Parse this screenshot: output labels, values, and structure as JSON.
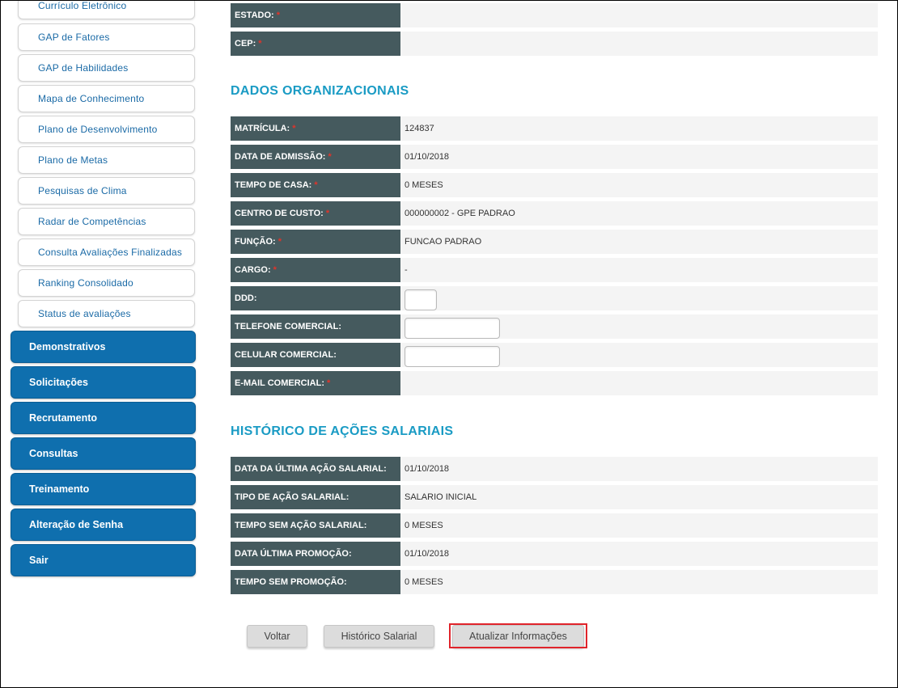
{
  "sidebar": {
    "subitems": [
      "Currículo Eletrônico",
      "GAP de Fatores",
      "GAP de Habilidades",
      "Mapa de Conhecimento",
      "Plano de Desenvolvimento",
      "Plano de Metas",
      "Pesquisas de Clima",
      "Radar de Competências",
      "Consulta Avaliações Finalizadas",
      "Ranking Consolidado",
      "Status de avaliações"
    ],
    "main_items": [
      "Demonstrativos",
      "Solicitações",
      "Recrutamento",
      "Consultas",
      "Treinamento",
      "Alteração de Senha",
      "Sair"
    ]
  },
  "address_rows": [
    {
      "label": "ESTADO:",
      "required": "*",
      "value": ""
    },
    {
      "label": "CEP:",
      "required": "*",
      "value": ""
    }
  ],
  "org_section": {
    "title": "DADOS ORGANIZACIONAIS",
    "rows": [
      {
        "label": "MATRÍCULA:",
        "required": "*",
        "value": "124837"
      },
      {
        "label": "DATA DE ADMISSÃO:",
        "required": "*",
        "value": "01/10/2018"
      },
      {
        "label": "TEMPO DE CASA:",
        "required": "*",
        "value": "0 MESES"
      },
      {
        "label": "CENTRO DE CUSTO:",
        "required": "*",
        "value": "000000002 - GPE PADRAO"
      },
      {
        "label": "FUNÇÃO:",
        "required": "*",
        "value": "FUNCAO PADRAO"
      },
      {
        "label": "CARGO:",
        "required": "*",
        "value": "-"
      },
      {
        "label": "DDD:",
        "value": ""
      },
      {
        "label": "TELEFONE COMERCIAL:",
        "value": ""
      },
      {
        "label": "CELULAR COMERCIAL:",
        "value": ""
      },
      {
        "label": "E-MAIL COMERCIAL:",
        "required": "*",
        "value": ""
      }
    ]
  },
  "salary_section": {
    "title": "HISTÓRICO DE AÇÕES SALARIAIS",
    "rows": [
      {
        "label": "DATA DA ÚLTIMA AÇÃO SALARIAL:",
        "value": "01/10/2018"
      },
      {
        "label": "TIPO DE AÇÃO SALARIAL:",
        "value": "SALARIO INICIAL"
      },
      {
        "label": "TEMPO SEM AÇÃO SALARIAL:",
        "value": "0 MESES"
      },
      {
        "label": "DATA ÚLTIMA PROMOÇÃO:",
        "value": "01/10/2018"
      },
      {
        "label": "TEMPO SEM PROMOÇÃO:",
        "value": "0 MESES"
      }
    ]
  },
  "buttons": {
    "back": "Voltar",
    "salary_history": "Histórico Salarial",
    "update_info": "Atualizar Informações"
  },
  "colors": {
    "label_bg": "#455a5e",
    "section_title": "#1a9bc4",
    "menu_blue": "#0f6fae",
    "required_marker": "#e0342b",
    "highlight": "#e0242b"
  }
}
